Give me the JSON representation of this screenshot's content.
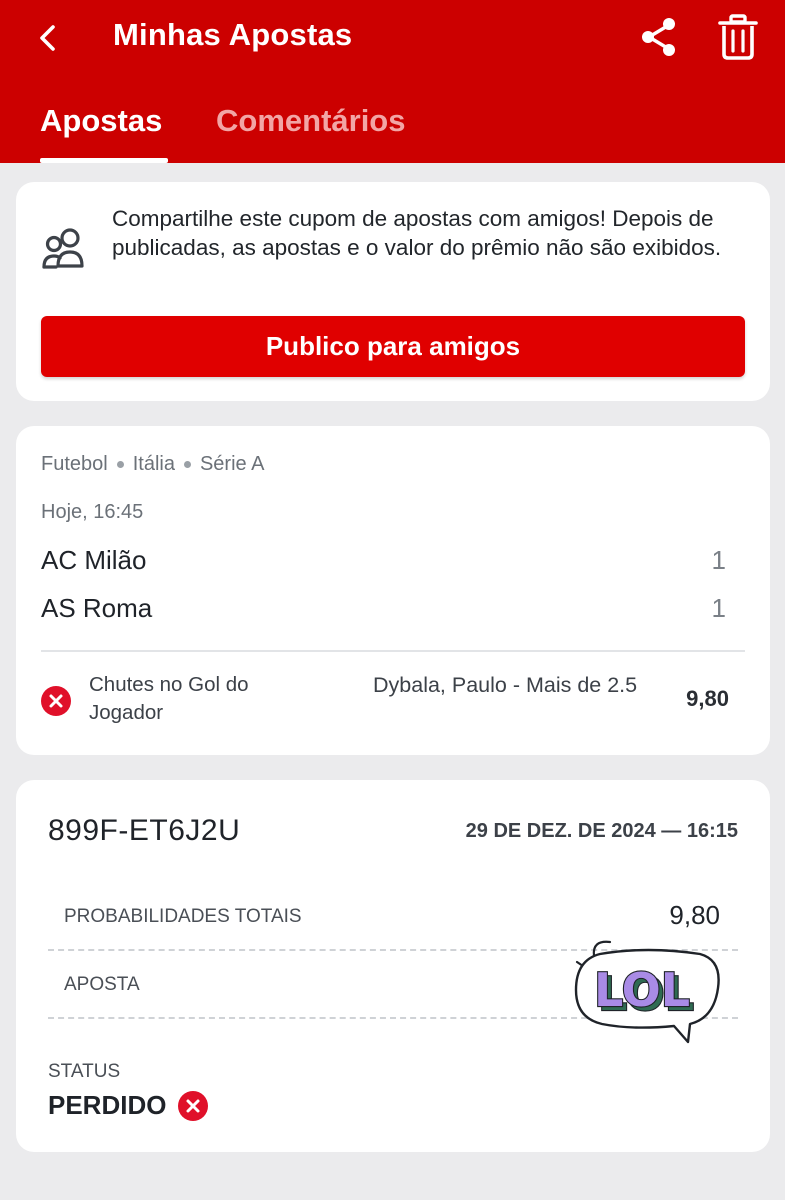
{
  "header": {
    "title": "Minhas Apostas",
    "tabs": [
      {
        "label": "Apostas",
        "active": true
      },
      {
        "label": "Comentários",
        "active": false
      }
    ],
    "accent": "#cc0000"
  },
  "share_card": {
    "text": "Compartilhe este cupom de apostas com amigos! Depois de publicadas, as apostas e o valor do prêmio não são exibidos.",
    "button_label": "Publico para amigos",
    "icon": "friends-icon"
  },
  "event": {
    "breadcrumb": [
      "Futebol",
      "Itália",
      "Série A"
    ],
    "time": "Hoje, 16:45",
    "home_team": "AC Milão",
    "home_score": "1",
    "away_team": "AS Roma",
    "away_score": "1",
    "market": "Chutes no Gol do Jogador",
    "selection": "Dybala, Paulo - Mais de 2.5",
    "odds": "9,80",
    "result_icon": "lost-x-icon"
  },
  "ticket": {
    "id": "899F-ET6J2U",
    "date": "29 DE DEZ. DE 2024 — 16:15",
    "total_odds_label": "PROBABILIDADES TOTAIS",
    "total_odds_value": "9,80",
    "bet_label": "APOSTA",
    "status_label": "STATUS",
    "status_value": "PERDIDO",
    "sticker_text": "LOL"
  },
  "colors": {
    "lost": "#e0102a",
    "button": "#e00000"
  }
}
